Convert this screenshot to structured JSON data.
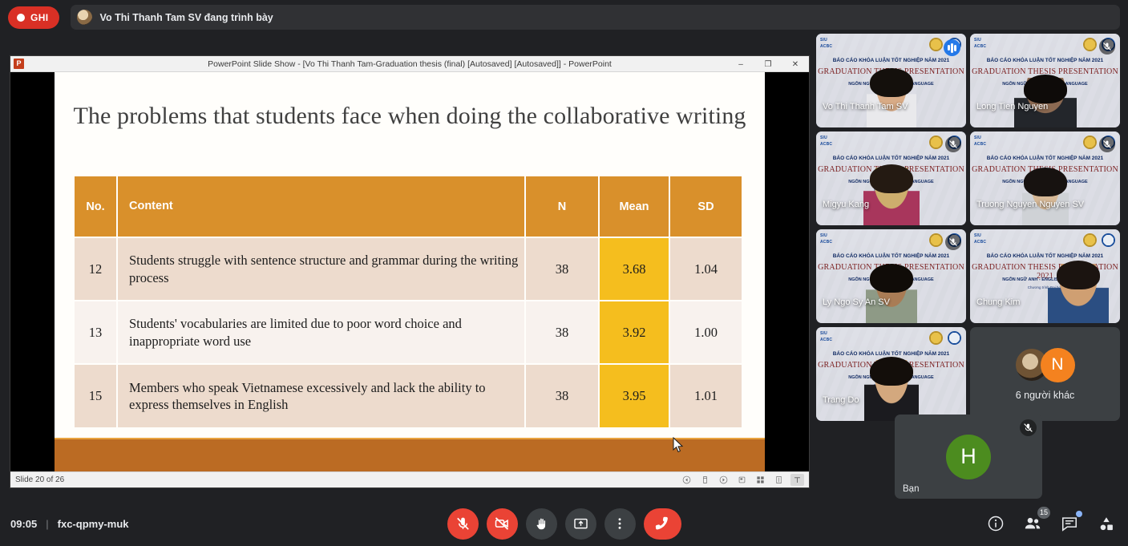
{
  "topbar": {
    "recording_label": "GHI",
    "recording_icon": "record-dot-icon",
    "presenting_text": "Vo Thi Thanh Tam SV đang trình bày"
  },
  "powerpoint": {
    "window_title": "PowerPoint Slide Show - [Vo Thi Thanh Tam-Graduation thesis (final) [Autosaved] [Autosaved]] - PowerPoint",
    "app_logo": "P",
    "minimize": "–",
    "restore": "❐",
    "close": "✕",
    "status_text": "Slide 20 of 26",
    "status_icons": [
      "previous-slide-icon",
      "pen-tools-icon",
      "next-slide-icon",
      "slide-view-icon",
      "all-slides-icon",
      "zoom-icon",
      "laser-pointer-icon"
    ]
  },
  "slide": {
    "title": "The problems that students face when doing the collaborative writing",
    "table": {
      "headers": [
        "No.",
        "Content",
        "N",
        "Mean",
        "SD"
      ],
      "rows": [
        {
          "no": "12",
          "content": "Students struggle with sentence structure and grammar during the writing process",
          "n": "38",
          "mean": "3.68",
          "sd": "1.04"
        },
        {
          "no": "13",
          "content": "Students' vocabularies are limited due to poor word choice and inappropriate word use",
          "n": "38",
          "mean": "3.92",
          "sd": "1.00"
        },
        {
          "no": "15",
          "content": "Members who speak Vietnamese excessively and lack the ability to express themselves in English",
          "n": "38",
          "mean": "3.95",
          "sd": "1.01"
        }
      ]
    },
    "colors": {
      "header_orange": "#d9902b",
      "mean_highlight": "#f5be1e",
      "row_band_a": "#eddbcd",
      "row_band_b": "#f8f2ee",
      "footer_band": "#bb6b23"
    }
  },
  "tiles": {
    "slide_overlay": {
      "logo_main": "SIU",
      "logo_sub": "ACBC",
      "line1": "BÁO CÁO KHÓA LUẬN TỐT NGHIỆP NĂM 2021",
      "line2": "GRADUATION THESIS PRESENTATION 2021",
      "line3": "NGÔN NGỮ ANH - ENGLISH LANGUAGE",
      "line4": "Chương trình Đại học"
    },
    "participants": [
      {
        "name": "Vo Thi Thanh Tam SV",
        "speaking": true,
        "muted": false
      },
      {
        "name": "Long Tien Nguyen",
        "speaking": false,
        "muted": true
      },
      {
        "name": "Migyu Kang",
        "speaking": false,
        "muted": true
      },
      {
        "name": "Truong Nguyen Nguyen SV",
        "speaking": false,
        "muted": true
      },
      {
        "name": "Ly Ngo Sy An SV",
        "speaking": false,
        "muted": true
      },
      {
        "name": "Chung Kim",
        "speaking": false,
        "muted": false
      },
      {
        "name": "Trang Do",
        "speaking": false,
        "muted": false
      }
    ],
    "others": {
      "label": "6 người khác",
      "avatar_letter": "N",
      "avatar_color": "#f4821f"
    }
  },
  "selfview": {
    "name": "Bạn",
    "avatar_letter": "H",
    "avatar_color": "#4c8c1f",
    "muted": true
  },
  "bottombar": {
    "time": "09:05",
    "separator": "|",
    "meeting_code": "fxc-qpmy-muk",
    "controls": [
      {
        "name": "microphone-off-button",
        "icon": "mic-muted-icon",
        "state": "off"
      },
      {
        "name": "camera-off-button",
        "icon": "camera-muted-icon",
        "state": "off"
      },
      {
        "name": "raise-hand-button",
        "icon": "hand-icon",
        "state": "on"
      },
      {
        "name": "present-screen-button",
        "icon": "present-icon",
        "state": "on"
      },
      {
        "name": "more-options-button",
        "icon": "more-vertical-icon",
        "state": "on"
      },
      {
        "name": "end-call-button",
        "icon": "hangup-icon",
        "state": "danger"
      }
    ],
    "right_icons": [
      {
        "name": "meeting-details-button",
        "icon": "info-icon",
        "badge": ""
      },
      {
        "name": "participants-button",
        "icon": "people-icon",
        "badge": "15"
      },
      {
        "name": "chat-button",
        "icon": "chat-icon",
        "badge": ""
      },
      {
        "name": "activities-button",
        "icon": "activities-icon",
        "badge": ""
      }
    ]
  }
}
